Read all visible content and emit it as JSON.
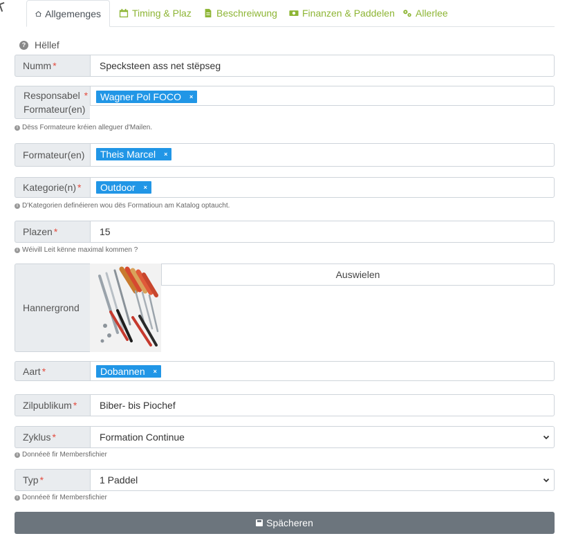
{
  "tabs": [
    {
      "label": "Allgemenges",
      "icon": "home-icon"
    },
    {
      "label": "Timing & Plaz",
      "icon": "calendar-icon"
    },
    {
      "label": "Beschreiwung",
      "icon": "document-icon"
    },
    {
      "label": "Finanzen & Paddelen",
      "icon": "money-icon"
    },
    {
      "label": "Allerlee",
      "icon": "gears-icon"
    }
  ],
  "help": {
    "label": "Hëllef"
  },
  "fields": {
    "numm": {
      "label": "Numm",
      "value": "Specksteen ass net stëpseg"
    },
    "responsabel": {
      "label_line1": "Responsabel",
      "label_line2": "Formateur(en)",
      "tag": "Wagner Pol FOCO",
      "hint": "Dëss Formateure kréien alleguer d'Mailen."
    },
    "formateur": {
      "label": "Formateur(en)",
      "tag": "Theis Marcel"
    },
    "kategorie": {
      "label": "Kategorie(n)",
      "tag": "Outdoor",
      "hint": "D'Kategorien definéieren wou dës Formatioun am Katalog optaucht."
    },
    "plazen": {
      "label": "Plazen",
      "value": "15",
      "hint": "Wéivill Leit kënne maximal kommen ?"
    },
    "hannergrond": {
      "label": "Hannergrond",
      "button": "Auswielen"
    },
    "aart": {
      "label": "Aart",
      "tag": "Dobannen"
    },
    "zilpublikum": {
      "label": "Zilpublikum",
      "value": "Biber- bis Piochef"
    },
    "zyklus": {
      "label": "Zyklus",
      "value": "Formation Continue",
      "hint": "Donnéeë fir Membersfichier"
    },
    "typ": {
      "label": "Typ",
      "value": "1 Paddel",
      "hint": "Donnéeë fir Membersfichier"
    }
  },
  "save": {
    "label": "Spächeren"
  },
  "colors": {
    "accent": "#8db534",
    "tag": "#2196e6",
    "required": "#e34b3e",
    "save_button": "#6c757d"
  }
}
